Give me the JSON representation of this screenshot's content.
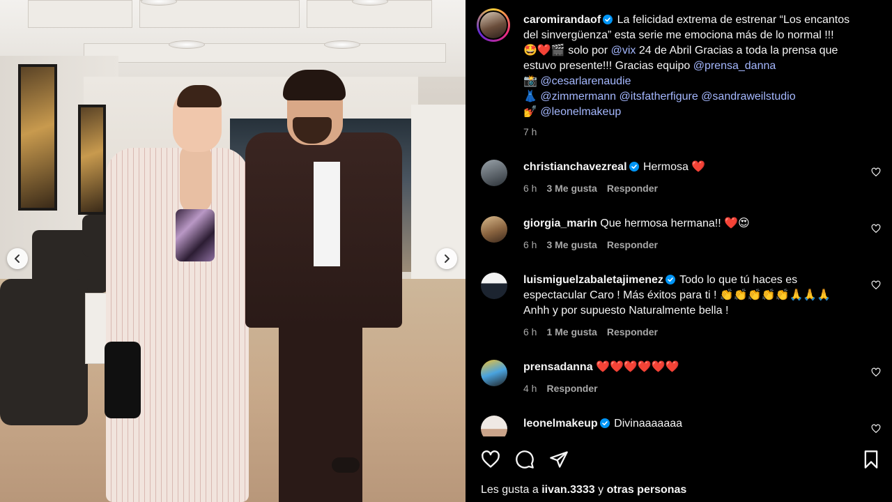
{
  "post": {
    "author": "caromirandaof",
    "caption_part1": "La felicidad extrema de estrenar “Los encantos del sinvergüenza” esta serie me emociona más de lo normal !!! 🤩❤️🎬 solo por",
    "mention_vix": "@vix",
    "caption_part2": "24 de Abril Gracias a toda la prensa que estuvo presente!!! Gracias equipo",
    "mention_prensa": "@prensa_danna",
    "line_photo_emoji": "📸",
    "mention_cesar": "@cesarlarenaudie",
    "line_dress_emoji": "👗",
    "mention_zimmermann": "@zimmermann",
    "mention_itsfather": "@itsfatherfigure",
    "mention_sandra": "@sandraweilstudio",
    "line_makeup_emoji": "💅",
    "mention_leonel": "@leonelmakeup",
    "time": "7 h"
  },
  "comments": [
    {
      "username": "christianchavezreal",
      "text": "Hermosa ❤️",
      "time": "6 h",
      "likes": "3 Me gusta",
      "reply": "Responder"
    },
    {
      "username": "giorgia_marin",
      "text": "Que hermosa hermana!! ❤️😍",
      "time": "6 h",
      "likes": "3 Me gusta",
      "reply": "Responder"
    },
    {
      "username": "luismiguelzabaletajimenez",
      "text_line1": "Todo lo que tú haces es",
      "text_line2": "espectacular Caro ! Más éxitos para ti ! 👏👏👏👏👏🙏🙏🙏",
      "text_line3": "Anhh y por supuesto Naturalmente bella !",
      "time": "6 h",
      "likes": "1 Me gusta",
      "reply": "Responder"
    },
    {
      "username": "prensadanna",
      "text": "❤️❤️❤️❤️❤️❤️",
      "time": "4 h",
      "reply": "Responder"
    },
    {
      "username": "leonelmakeup",
      "text": "Divinaaaaaaa"
    }
  ],
  "likes_summary": {
    "prefix": "Les gusta a",
    "user": "iivan.3333",
    "middle": "y",
    "others": "otras personas"
  },
  "icons": {
    "like": "heart-icon",
    "comment": "comment-icon",
    "share": "share-icon",
    "save": "bookmark-icon",
    "prev": "chevron-left-icon",
    "next": "chevron-right-icon"
  },
  "colors": {
    "background": "#000000",
    "text": "#f5f5f5",
    "link": "#a5b8ff",
    "muted": "#a8a8a8",
    "verified": "#0095f6"
  }
}
